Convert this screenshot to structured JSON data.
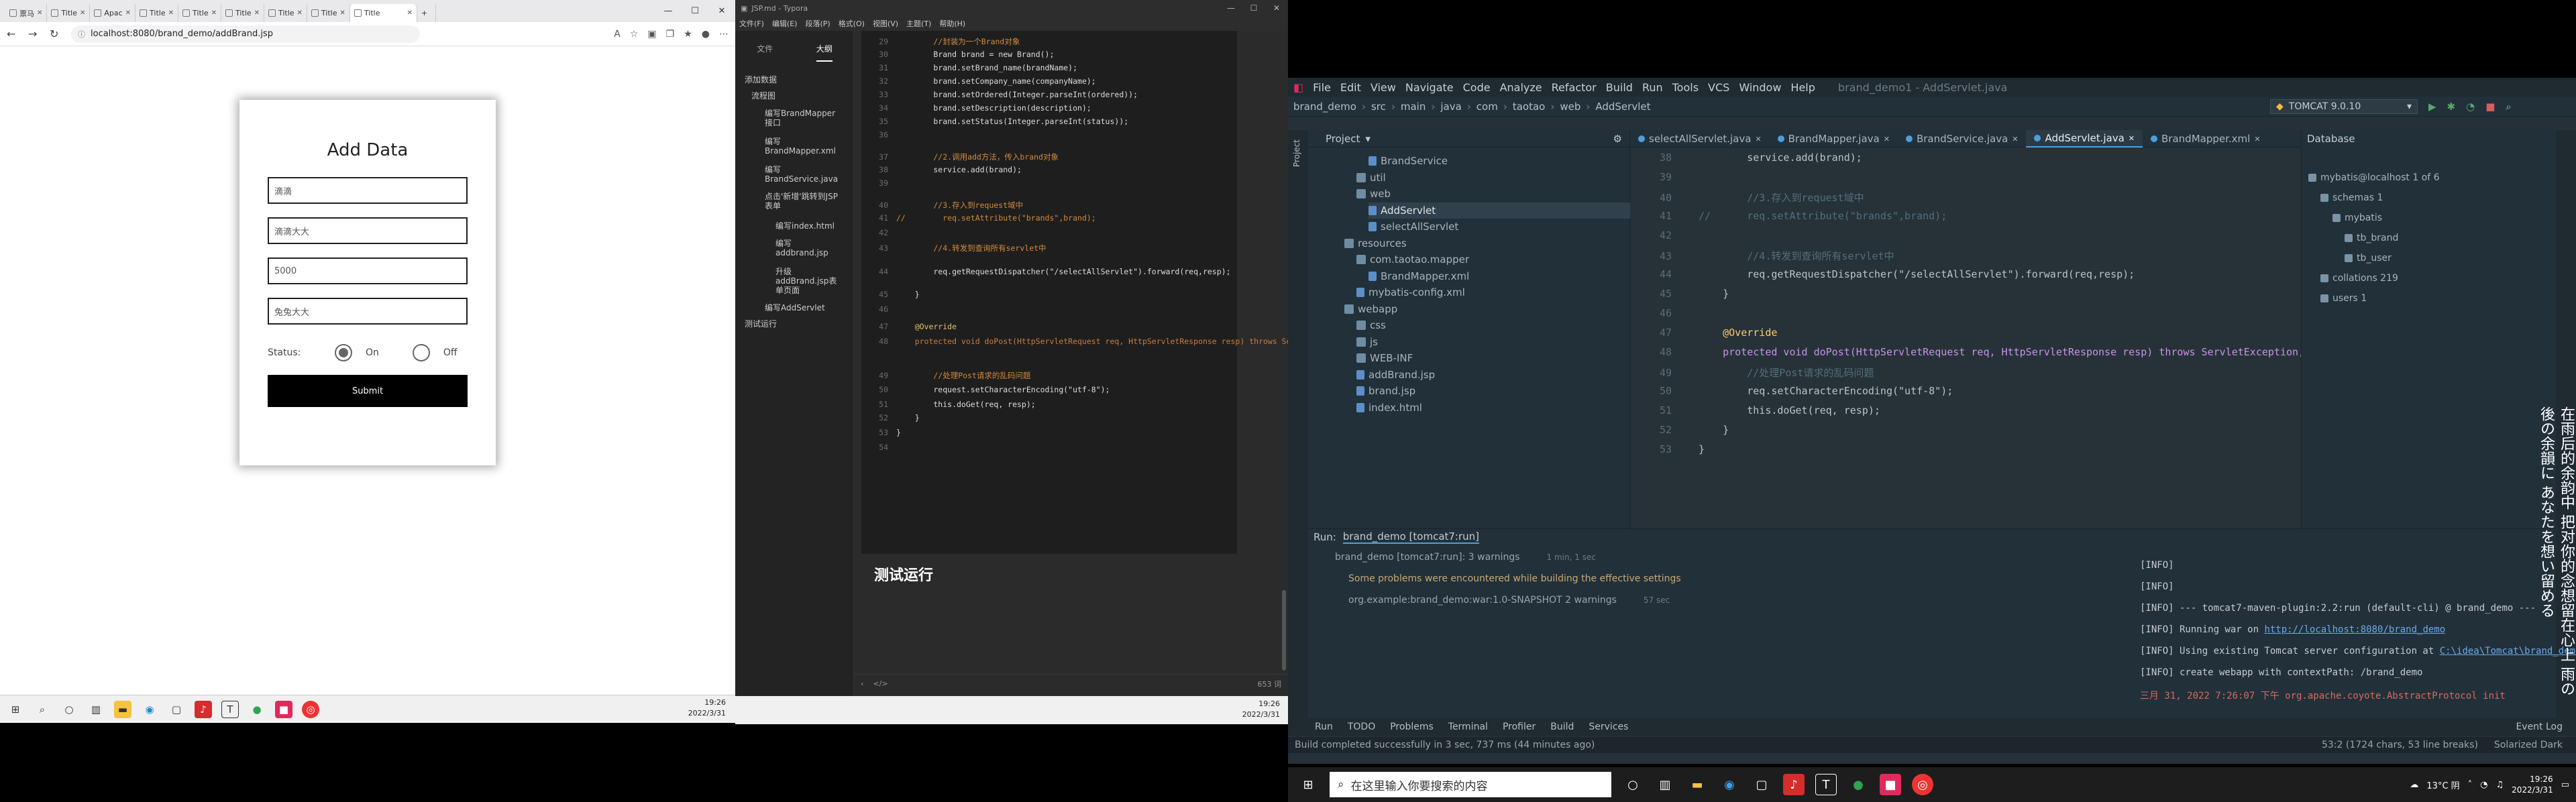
{
  "browser": {
    "tabs": [
      {
        "label": "票马"
      },
      {
        "label": "Title"
      },
      {
        "label": "Apac"
      },
      {
        "label": "Title"
      },
      {
        "label": "Title"
      },
      {
        "label": "Title"
      },
      {
        "label": "Title"
      },
      {
        "label": "Title"
      },
      {
        "label": "Title"
      }
    ],
    "new_tab": "+",
    "url": "localhost:8080/brand_demo/addBrand.jsp",
    "form": {
      "title": "Add Data",
      "brand_name": "滴滴",
      "company_name": "滴滴大大",
      "ordered": "5000",
      "description": "兔兔大大",
      "status_label": "Status:",
      "status_on": "On",
      "status_off": "Off",
      "submit": "Submit"
    },
    "clock_time": "19:26",
    "clock_date": "2022/3/31"
  },
  "typora": {
    "title": "JSP.md - Typora",
    "menu": [
      "文件(F)",
      "编辑(E)",
      "段落(P)",
      "格式(O)",
      "视图(V)",
      "主题(T)",
      "帮助(H)"
    ],
    "side_tabs": [
      "文件",
      "大纲"
    ],
    "outline": [
      "添加数据",
      "流程图",
      "编写BrandMapper接口",
      "编写BrandMapper.xml",
      "编写BrandService.java",
      "点击'新增'跳转到JSP表单",
      "编写index.html",
      "编写addbrand.jsp",
      "升级addBrand.jsp表单页面",
      "编写AddServlet",
      "测试运行"
    ],
    "code": [
      {
        "n": "29",
        "t": "        //封装为一个Brand对象"
      },
      {
        "n": "30",
        "t": "        Brand brand = new Brand();"
      },
      {
        "n": "31",
        "t": "        brand.setBrand_name(brandName);"
      },
      {
        "n": "32",
        "t": "        brand.setCompany_name(companyName);"
      },
      {
        "n": "33",
        "t": "        brand.setOrdered(Integer.parseInt(ordered));"
      },
      {
        "n": "34",
        "t": "        brand.setDescription(description);"
      },
      {
        "n": "35",
        "t": "        brand.setStatus(Integer.parseInt(status));"
      },
      {
        "n": "36",
        "t": ""
      },
      {
        "n": "37",
        "t": "        //2.调用add方法，传入brand对象"
      },
      {
        "n": "38",
        "t": "        service.add(brand);"
      },
      {
        "n": "39",
        "t": ""
      },
      {
        "n": "40",
        "t": "        //3.存入到request域中"
      },
      {
        "n": "41",
        "t": "//        req.setAttribute(\"brands\",brand);"
      },
      {
        "n": "42",
        "t": ""
      },
      {
        "n": "43",
        "t": "        //4.转发到查询所有servlet中"
      },
      {
        "n": "44",
        "t": "        req.getRequestDispatcher(\"/selectAllServlet\").forward(req,resp);"
      },
      {
        "n": "45",
        "t": "    }"
      },
      {
        "n": "46",
        "t": ""
      },
      {
        "n": "47",
        "t": "    @Override"
      },
      {
        "n": "48",
        "t": "    protected void doPost(HttpServletRequest req, HttpServletResponse resp) throws ServletException, IOException {"
      },
      {
        "n": "49",
        "t": "        //处理Post请求的乱码问题"
      },
      {
        "n": "50",
        "t": "        request.setCharacterEncoding(\"utf-8\");"
      },
      {
        "n": "51",
        "t": "        this.doGet(req, resp);"
      },
      {
        "n": "52",
        "t": "    }"
      },
      {
        "n": "53",
        "t": "}"
      },
      {
        "n": "54",
        "t": ""
      }
    ],
    "heading": "测试运行",
    "word_count": "653 词",
    "clock_time": "19:26",
    "clock_date": "2022/3/31"
  },
  "idea": {
    "menu": [
      "File",
      "Edit",
      "View",
      "Navigate",
      "Code",
      "Analyze",
      "Refactor",
      "Build",
      "Run",
      "Tools",
      "VCS",
      "Window",
      "Help",
      "brand_demo1 - AddServlet.java"
    ],
    "breadcrumb": [
      "brand_demo",
      "src",
      "main",
      "java",
      "com",
      "taotao",
      "web",
      "AddServlet"
    ],
    "run_config": "TOMCAT 9.0.10",
    "project_label": "Project",
    "tree": [
      {
        "label": "BrandService",
        "indent": 5,
        "kind": "file"
      },
      {
        "label": "util",
        "indent": 4,
        "kind": "folder"
      },
      {
        "label": "web",
        "indent": 4,
        "kind": "folder"
      },
      {
        "label": "AddServlet",
        "indent": 5,
        "kind": "file"
      },
      {
        "label": "selectAllServlet",
        "indent": 5,
        "kind": "file"
      },
      {
        "label": "resources",
        "indent": 3,
        "kind": "folder"
      },
      {
        "label": "com.taotao.mapper",
        "indent": 4,
        "kind": "folder"
      },
      {
        "label": "BrandMapper.xml",
        "indent": 5,
        "kind": "file"
      },
      {
        "label": "mybatis-config.xml",
        "indent": 4,
        "kind": "file"
      },
      {
        "label": "webapp",
        "indent": 3,
        "kind": "folder"
      },
      {
        "label": "css",
        "indent": 4,
        "kind": "folder"
      },
      {
        "label": "js",
        "indent": 4,
        "kind": "folder"
      },
      {
        "label": "WEB-INF",
        "indent": 4,
        "kind": "folder"
      },
      {
        "label": "addBrand.jsp",
        "indent": 4,
        "kind": "file"
      },
      {
        "label": "brand.jsp",
        "indent": 4,
        "kind": "file"
      },
      {
        "label": "index.html",
        "indent": 4,
        "kind": "file"
      }
    ],
    "tabs": [
      {
        "label": "selectAllServlet.java",
        "active": false
      },
      {
        "label": "BrandMapper.java",
        "active": false
      },
      {
        "label": "BrandService.java",
        "active": false
      },
      {
        "label": "AddServlet.java",
        "active": true
      },
      {
        "label": "BrandMapper.xml",
        "active": false
      }
    ],
    "code": [
      {
        "n": "38",
        "t": "        service.add(brand);"
      },
      {
        "n": "39",
        "t": ""
      },
      {
        "n": "40",
        "t": "        //3.存入到request域中"
      },
      {
        "n": "41",
        "t": "//      req.setAttribute(\"brands\",brand);"
      },
      {
        "n": "42",
        "t": ""
      },
      {
        "n": "43",
        "t": "        //4.转发到查询所有servlet中"
      },
      {
        "n": "44",
        "t": "        req.getRequestDispatcher(\"/selectAllServlet\").forward(req,resp);"
      },
      {
        "n": "45",
        "t": "    }"
      },
      {
        "n": "46",
        "t": ""
      },
      {
        "n": "47",
        "t": "    @Override"
      },
      {
        "n": "48",
        "t": "    protected void doPost(HttpServletRequest req, HttpServletResponse resp) throws ServletException,"
      },
      {
        "n": "49",
        "t": "        //处理Post请求的乱码问题"
      },
      {
        "n": "50",
        "t": "        req.setCharacterEncoding(\"utf-8\");"
      },
      {
        "n": "51",
        "t": "        this.doGet(req, resp);"
      },
      {
        "n": "52",
        "t": "    }"
      },
      {
        "n": "53",
        "t": "}"
      }
    ],
    "db_title": "Database",
    "db_tree": [
      {
        "label": "mybatis@localhost 1 of 6",
        "indent": 0
      },
      {
        "label": "schemas 1",
        "indent": 1
      },
      {
        "label": "mybatis",
        "indent": 2
      },
      {
        "label": "tb_brand",
        "indent": 3
      },
      {
        "label": "tb_user",
        "indent": 3
      },
      {
        "label": "collations 219",
        "indent": 1
      },
      {
        "label": "users 1",
        "indent": 1
      }
    ],
    "run_tab": "Run:",
    "run_name": "brand_demo [tomcat7:run]",
    "run_tree": [
      {
        "label": "brand_demo [tomcat7:run]: 3 warnings",
        "time": "1 min, 1 sec"
      },
      {
        "label": "Some problems were encountered while building the effective settings",
        "time": ""
      },
      {
        "label": "org.example:brand_demo:war:1.0-SNAPSHOT 2 warnings",
        "time": "57 sec"
      }
    ],
    "output": [
      "[INFO]",
      "[INFO]",
      "[INFO] --- tomcat7-maven-plugin:2.2:run (default-cli) @ brand_demo ---",
      "[INFO] Running war on ",
      "[INFO] Using existing Tomcat server configuration at ",
      "[INFO] create webapp with contextPath: /brand_demo",
      "三月 31, 2022 7:26:07 下午 org.apache.coyote.AbstractProtocol init"
    ],
    "link_url": "http://localhost:8080/brand_demo",
    "link_path": "C:\\idea\\Tomcat\\brand_demo\\target\\tomcat",
    "bottom_tabs": [
      "Run",
      "TODO",
      "Problems",
      "Terminal",
      "Profiler",
      "Build",
      "Services",
      "Event Log"
    ],
    "status_left": "Build completed successfully in 3 sec, 737 ms (44 minutes ago)",
    "status_pos": "53:2 (1724 chars, 53 line breaks)",
    "status_theme": "Solarized Dark",
    "jp_text": "在雨后的余韵中 把对你的念想留在心上 雨の後の余韻に あなたを想い留める"
  },
  "taskbar_right": {
    "search_placeholder": "在这里输入你要搜索的内容",
    "weather": "13°C 阴",
    "time": "19:26",
    "date": "2022/3/31"
  },
  "colors": {
    "idea_bg": "#263238",
    "idea_accent": "#4e9edc",
    "typora_bg": "#1e1e1e",
    "submit_bg": "#000000"
  }
}
